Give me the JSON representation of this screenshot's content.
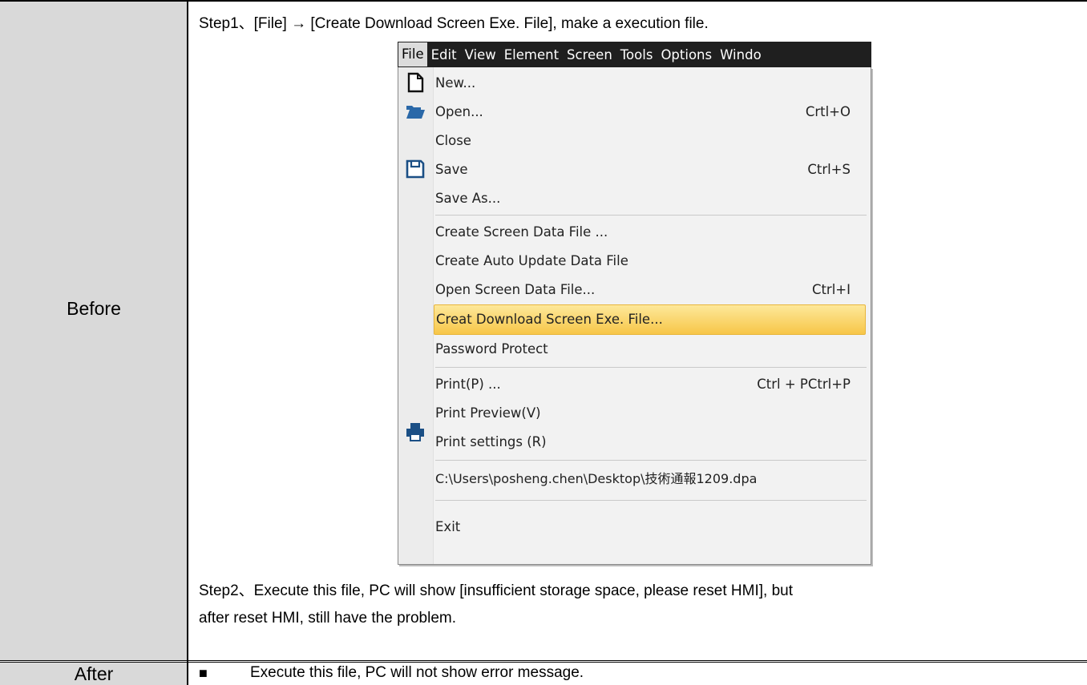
{
  "rows": {
    "before_label": "Before",
    "after_label": "After"
  },
  "step1": "Step1、[File] → [Create Download Screen Exe. File], make a execution file.",
  "step2_line1": "Step2、Execute this file, PC will show [insufficient storage space, please reset HMI], but",
  "step2_line2": "after reset HMI, still have the problem.",
  "after_bullet": "■",
  "after_text": "Execute this file, PC will not show error message.",
  "menubar": {
    "items": [
      "File",
      "Edit",
      "View",
      "Element",
      "Screen",
      "Tools",
      "Options",
      "Windo"
    ]
  },
  "file_menu": {
    "items": [
      {
        "label": "New...",
        "shortcut": "",
        "icon": "new-file-icon"
      },
      {
        "label": "Open...",
        "shortcut": "Crtl+O",
        "icon": "open-folder-icon"
      },
      {
        "label": "Close",
        "shortcut": ""
      },
      {
        "label": "Save",
        "shortcut": "Ctrl+S",
        "icon": "save-icon"
      },
      {
        "label": "Save As...",
        "shortcut": ""
      },
      {
        "label": "Create Screen Data File ...",
        "shortcut": ""
      },
      {
        "label": "Create Auto Update Data File",
        "shortcut": ""
      },
      {
        "label": "Open Screen Data File...",
        "shortcut": "Ctrl+I"
      },
      {
        "label": "Creat Download Screen Exe. File...",
        "shortcut": "",
        "highlighted": true
      },
      {
        "label": "Password Protect",
        "shortcut": ""
      },
      {
        "label": "Print(P) ...",
        "shortcut": "Ctrl + PCtrl+P",
        "icon": "printer-icon"
      },
      {
        "label": "Print Preview(V)",
        "shortcut": ""
      },
      {
        "label": "Print settings (R)",
        "shortcut": ""
      },
      {
        "label": "C:\\Users\\posheng.chen\\Desktop\\技術通報1209.dpa",
        "shortcut": ""
      },
      {
        "label": "Exit",
        "shortcut": ""
      }
    ]
  },
  "colors": {
    "label_column": "#d9d9d9",
    "menubar": "#1f1f1f",
    "highlight": "#f7c648"
  }
}
